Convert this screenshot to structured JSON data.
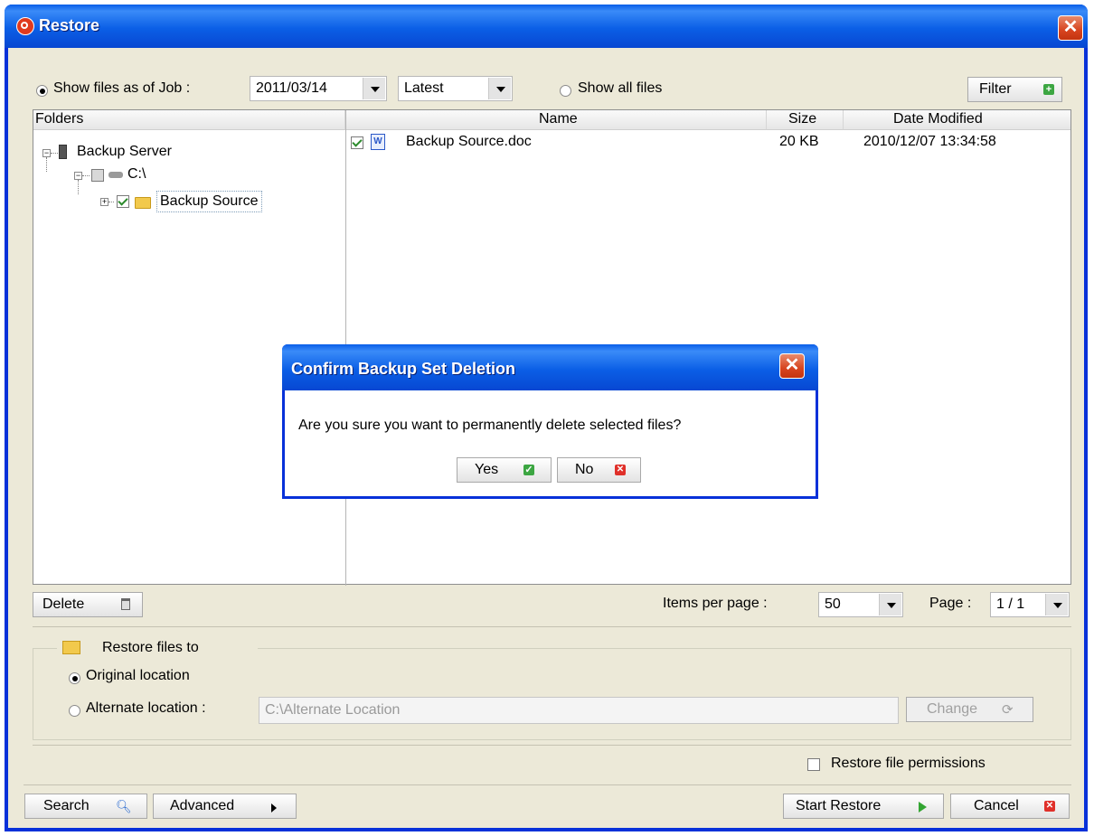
{
  "window": {
    "title": "Restore"
  },
  "options": {
    "show_as_of_job_label": "Show files as of Job :",
    "job_date": "2011/03/14",
    "version": "Latest",
    "show_all_label": "Show all files",
    "filter_label": "Filter"
  },
  "folders_header": "Folders",
  "tree": {
    "server": "Backup Server",
    "drive": "C:\\",
    "folder": "Backup Source"
  },
  "files": {
    "columns": {
      "name": "Name",
      "size": "Size",
      "date": "Date Modified"
    },
    "rows": [
      {
        "name": "Backup Source.doc",
        "size": "20 KB",
        "date": "2010/12/07 13:34:58",
        "checked": true
      }
    ]
  },
  "toolbar": {
    "delete_label": "Delete",
    "items_per_page_label": "Items per page :",
    "items_per_page": "50",
    "page_label": "Page :",
    "page_value": "1 / 1"
  },
  "restore_to": {
    "legend": "Restore files to",
    "original_label": "Original location",
    "alternate_label": "Alternate location :",
    "alternate_placeholder": "C:\\Alternate Location",
    "change_label": "Change"
  },
  "permissions_label": "Restore file permissions",
  "bottom": {
    "search_label": "Search",
    "advanced_label": "Advanced",
    "start_label": "Start Restore",
    "cancel_label": "Cancel"
  },
  "dialog": {
    "title": "Confirm Backup Set Deletion",
    "message": "Are you sure you want to permanently delete selected files?",
    "yes_label": "Yes",
    "no_label": "No"
  }
}
